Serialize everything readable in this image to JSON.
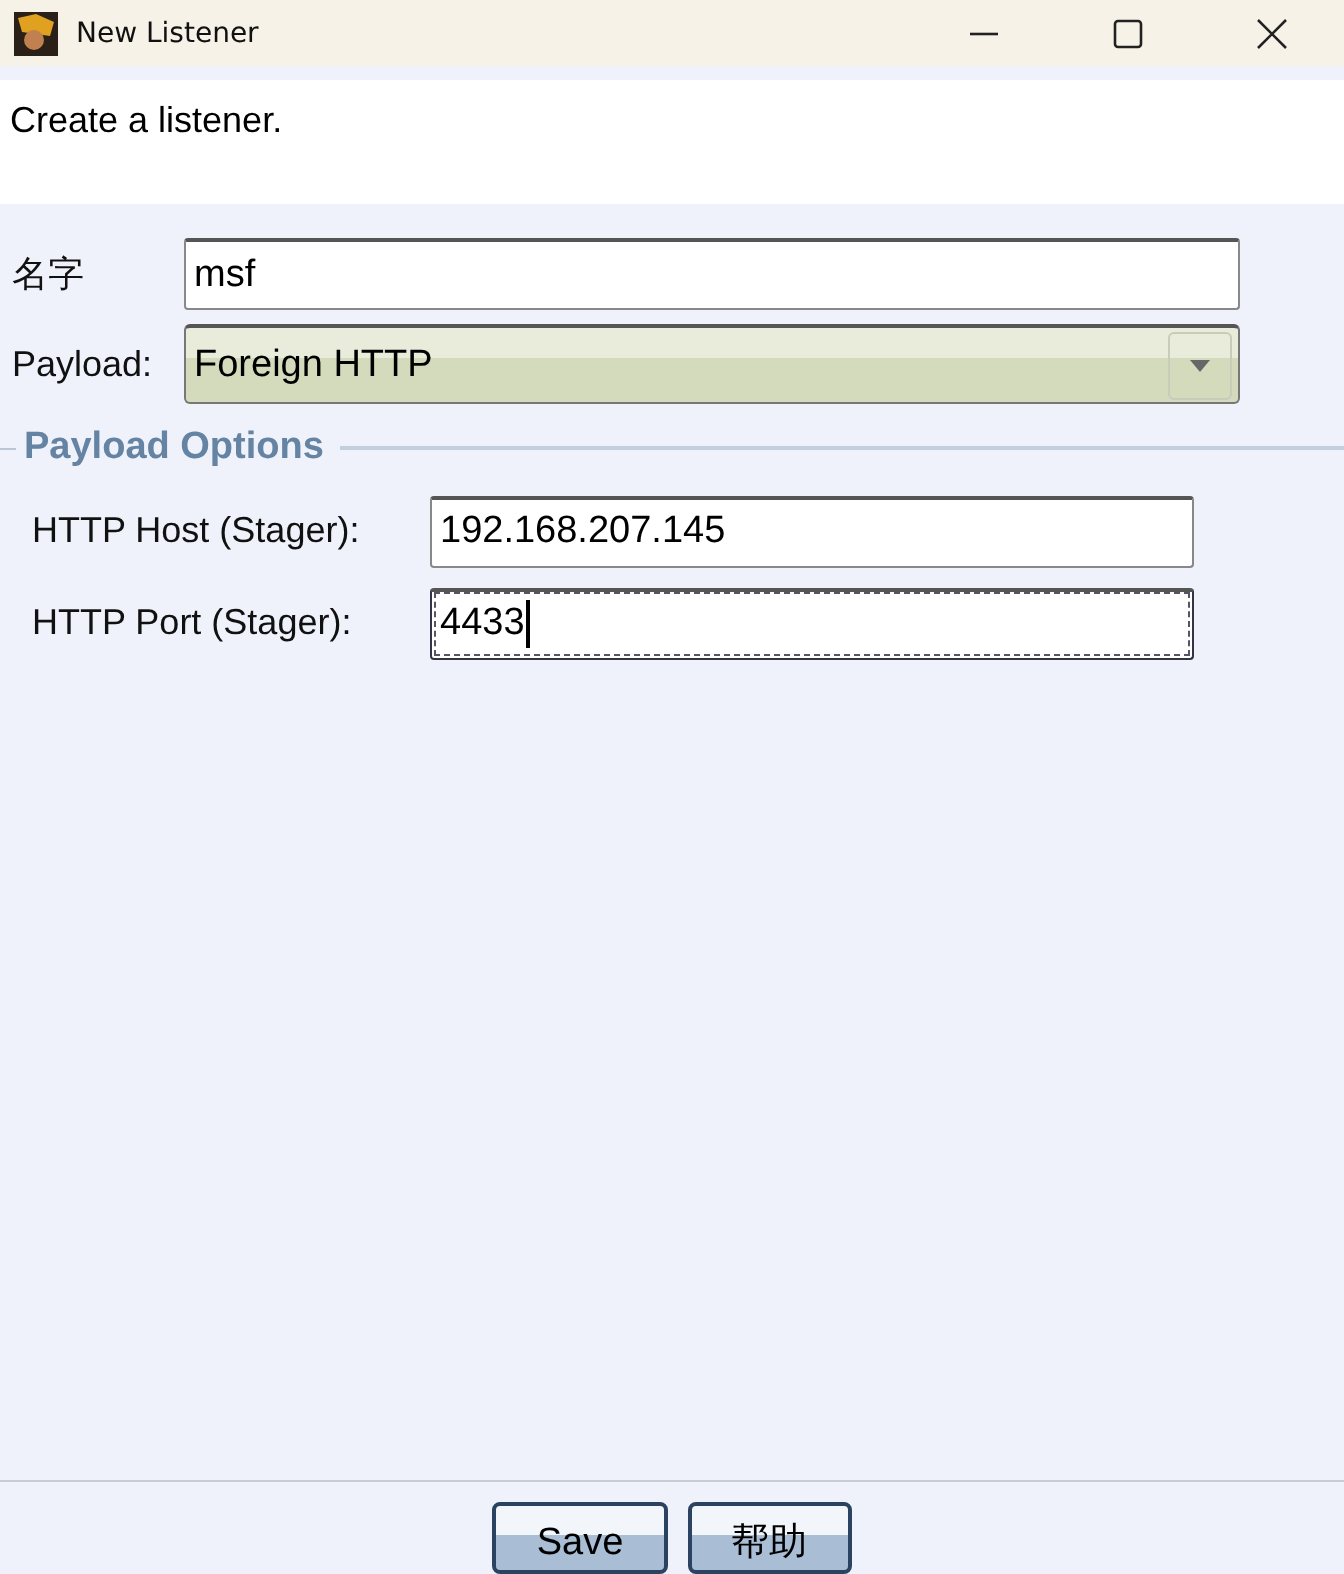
{
  "window": {
    "title": "New Listener"
  },
  "description": "Create a listener.",
  "fields": [
    {
      "label": "名字",
      "value": "msf",
      "kind": "text"
    },
    {
      "label": "Payload:",
      "value": "Foreign HTTP",
      "kind": "select"
    }
  ],
  "options": {
    "title": "Payload Options",
    "fields": [
      {
        "label": "HTTP Host (Stager):",
        "value": "192.168.207.145",
        "focused": false
      },
      {
        "label": "HTTP Port (Stager):",
        "value": "4433",
        "focused": true
      }
    ]
  },
  "buttons": [
    "Save",
    "帮助"
  ]
}
